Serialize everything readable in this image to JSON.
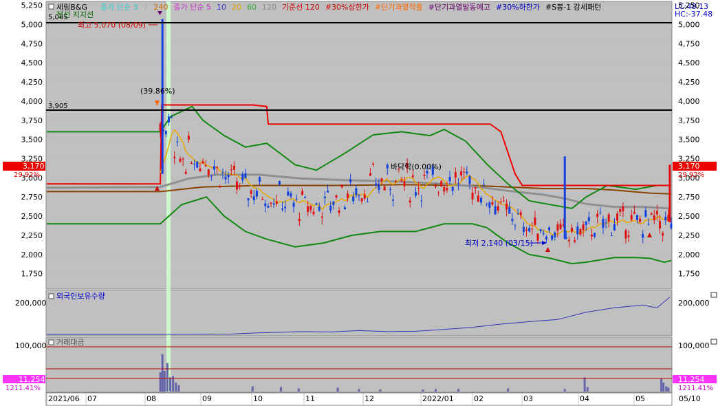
{
  "legend": {
    "title": "세림B&G",
    "items": [
      {
        "text": "종가 단순 3",
        "color": "#33cccc"
      },
      {
        "text": "7",
        "color": "#aaaaaa"
      },
      {
        "text": "240",
        "color": "#cc6600"
      },
      {
        "text": "종가 단순 5",
        "color": "#cc33cc"
      },
      {
        "text": "10",
        "color": "#3333cc"
      },
      {
        "text": "20",
        "color": "#e0a000"
      },
      {
        "text": "60",
        "color": "#33aa33"
      },
      {
        "text": "120",
        "color": "#888888"
      },
      {
        "text": "기준선 120",
        "color": "#cc0000"
      },
      {
        "text": "#30%상한가",
        "color": "#cc0000"
      },
      {
        "text": "#단기과열적출",
        "color": "#ff6600"
      },
      {
        "text": "#단기과열발동예고",
        "color": "#660066"
      },
      {
        "text": "#30%하한가",
        "color": "#0000cc"
      },
      {
        "text": "#S봉-1 강세패턴",
        "color": "#000000"
      }
    ],
    "support_label": "전선 지지선",
    "lc": "LC:48.13",
    "hc": "HC:-37.48"
  },
  "price_axis": {
    "ticks": [
      "5,250",
      "5,000",
      "4,750",
      "4,500",
      "4,250",
      "4,000",
      "3,750",
      "3,500",
      "3,250",
      "3,000",
      "2,750",
      "2,500",
      "2,250",
      "2,000",
      "1,750"
    ],
    "current_price": "3,170",
    "current_pct": "29.92%"
  },
  "annotations": {
    "high": "최고 5,070 (08/09)",
    "low": "최저 2,140 (03/15)",
    "pct": "(39.86%)",
    "mid": "바닥락(0.00%)",
    "line_5065": "5,065",
    "line_3905": "3,905"
  },
  "foreign_panel": {
    "title": "외국인보유수량",
    "ticks": [
      "200,000"
    ]
  },
  "volume_panel": {
    "title": "거래대금",
    "ticks": [
      "100,000"
    ],
    "current": "11,254",
    "current_pct": "1211.41%"
  },
  "x_axis": {
    "labels": [
      "2021/06",
      "07",
      "08",
      "09",
      "10",
      "11",
      "12",
      "2022/01",
      "02",
      "03",
      "04",
      "05",
      "05/10"
    ]
  },
  "colors": {
    "up": "#e01010",
    "down": "#1040e0",
    "panel_bg": "#c0c0c0",
    "bollinger": "#118811",
    "baseline": "#ee0000",
    "ma20": "#e8a800",
    "ma120": "#909090",
    "ma240": "#884400",
    "foreign": "#3333bb"
  },
  "chart_data": {
    "type": "candlestick",
    "price_range": [
      1550,
      5300
    ],
    "horizontal_lines": [
      5065,
      3905
    ],
    "high": {
      "value": 5070,
      "date": "08/09"
    },
    "low": {
      "value": 2140,
      "date": "03/15"
    },
    "current": 3170,
    "periods": [
      "2021/06",
      "07",
      "08",
      "09",
      "10",
      "11",
      "12",
      "2022/01",
      "02",
      "03",
      "04",
      "05"
    ],
    "baseline_120": [
      [
        0,
        2920
      ],
      [
        160,
        2920
      ],
      [
        162,
        3950
      ],
      [
        290,
        3950
      ],
      [
        310,
        3930
      ],
      [
        312,
        3700
      ],
      [
        625,
        3700
      ],
      [
        640,
        3600
      ],
      [
        660,
        3050
      ],
      [
        670,
        2900
      ],
      [
        880,
        2900
      ]
    ],
    "bollinger_upper": [
      [
        0,
        3600
      ],
      [
        160,
        3600
      ],
      [
        175,
        3800
      ],
      [
        205,
        3930
      ],
      [
        220,
        3750
      ],
      [
        250,
        3550
      ],
      [
        280,
        3400
      ],
      [
        310,
        3450
      ],
      [
        350,
        3170
      ],
      [
        380,
        3100
      ],
      [
        420,
        3320
      ],
      [
        460,
        3560
      ],
      [
        500,
        3600
      ],
      [
        540,
        3550
      ],
      [
        560,
        3630
      ],
      [
        590,
        3480
      ],
      [
        620,
        3180
      ],
      [
        650,
        2920
      ],
      [
        680,
        2700
      ],
      [
        740,
        2600
      ],
      [
        760,
        2750
      ],
      [
        790,
        2900
      ],
      [
        830,
        2850
      ],
      [
        860,
        2900
      ],
      [
        880,
        2900
      ]
    ],
    "bollinger_lower": [
      [
        0,
        2400
      ],
      [
        160,
        2400
      ],
      [
        190,
        2650
      ],
      [
        225,
        2750
      ],
      [
        250,
        2500
      ],
      [
        280,
        2300
      ],
      [
        310,
        2200
      ],
      [
        350,
        2100
      ],
      [
        390,
        2150
      ],
      [
        430,
        2250
      ],
      [
        470,
        2300
      ],
      [
        520,
        2300
      ],
      [
        560,
        2400
      ],
      [
        600,
        2400
      ],
      [
        620,
        2350
      ],
      [
        650,
        2150
      ],
      [
        680,
        2000
      ],
      [
        710,
        1950
      ],
      [
        740,
        1880
      ],
      [
        760,
        1900
      ],
      [
        800,
        1960
      ],
      [
        830,
        1960
      ],
      [
        850,
        1950
      ],
      [
        870,
        1900
      ],
      [
        880,
        1920
      ]
    ],
    "ma120": [
      [
        0,
        2870
      ],
      [
        160,
        2880
      ],
      [
        200,
        2990
      ],
      [
        240,
        3040
      ],
      [
        300,
        3040
      ],
      [
        360,
        2990
      ],
      [
        420,
        2970
      ],
      [
        500,
        2950
      ],
      [
        560,
        2920
      ],
      [
        600,
        2890
      ],
      [
        650,
        2830
      ],
      [
        700,
        2780
      ],
      [
        730,
        2730
      ],
      [
        760,
        2660
      ],
      [
        800,
        2620
      ],
      [
        840,
        2620
      ],
      [
        880,
        2600
      ]
    ],
    "ma240": [
      [
        0,
        2820
      ],
      [
        160,
        2820
      ],
      [
        220,
        2880
      ],
      [
        300,
        2900
      ],
      [
        400,
        2900
      ],
      [
        500,
        2910
      ],
      [
        600,
        2900
      ],
      [
        650,
        2880
      ],
      [
        700,
        2860
      ],
      [
        760,
        2860
      ],
      [
        800,
        2840
      ],
      [
        850,
        2800
      ],
      [
        880,
        2790
      ]
    ],
    "foreign_holdings": [
      [
        0,
        0
      ],
      [
        160,
        0
      ],
      [
        200,
        600
      ],
      [
        260,
        2500
      ],
      [
        300,
        9000
      ],
      [
        360,
        16000
      ],
      [
        400,
        14000
      ],
      [
        440,
        22000
      ],
      [
        480,
        16000
      ],
      [
        520,
        18000
      ],
      [
        560,
        28000
      ],
      [
        600,
        40000
      ],
      [
        640,
        58000
      ],
      [
        680,
        72000
      ],
      [
        720,
        84000
      ],
      [
        760,
        125000
      ],
      [
        800,
        150000
      ],
      [
        840,
        165000
      ],
      [
        860,
        150000
      ],
      [
        878,
        210000
      ]
    ],
    "volume_spikes": [
      [
        160,
        30000
      ],
      [
        163,
        58000
      ],
      [
        166,
        32000
      ],
      [
        170,
        44000
      ],
      [
        174,
        22000
      ],
      [
        178,
        24000
      ],
      [
        182,
        14000
      ],
      [
        186,
        10000
      ],
      [
        290,
        8000
      ],
      [
        330,
        7000
      ],
      [
        355,
        5000
      ],
      [
        410,
        6000
      ],
      [
        440,
        4000
      ],
      [
        470,
        3500
      ],
      [
        530,
        3000
      ],
      [
        548,
        4000
      ],
      [
        580,
        4000
      ],
      [
        650,
        5000
      ],
      [
        730,
        4000
      ],
      [
        758,
        22000
      ],
      [
        762,
        7000
      ],
      [
        866,
        20000
      ],
      [
        869,
        14000
      ],
      [
        873,
        8000
      ],
      [
        876,
        6000
      ]
    ]
  }
}
